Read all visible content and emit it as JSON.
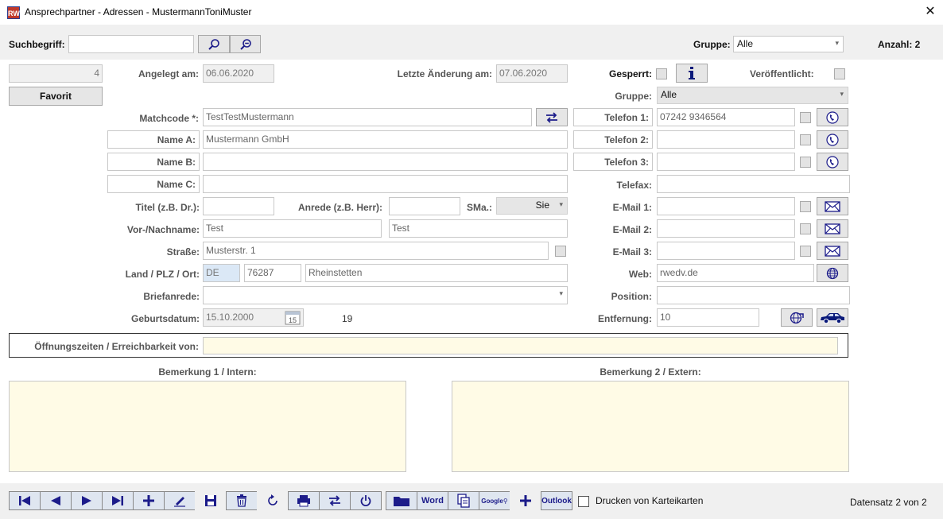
{
  "window": {
    "title": "Ansprechpartner - Adressen - MustermannToniMuster",
    "app_icon": "RW"
  },
  "search": {
    "label": "Suchbegriff:",
    "value": "",
    "group_label": "Gruppe:",
    "group_value": "Alle",
    "count_label": "Anzahl: 2"
  },
  "record": {
    "id": "4",
    "favorite_label": "Favorit",
    "created_label": "Angelegt am:",
    "created": "06.06.2020",
    "changed_label": "Letzte Änderung am:",
    "changed": "07.06.2020",
    "blocked_label": "Gesperrt:",
    "published_label": "Veröffentlicht:",
    "group_label": "Gruppe:",
    "group_value": "Alle",
    "matchcode_label": "Matchcode *:",
    "matchcode": "TestTestMustermann",
    "name_a_label": "Name A:",
    "name_a": "Mustermann GmbH",
    "name_b_label": "Name B:",
    "name_b": "",
    "name_c_label": "Name C:",
    "name_c": "",
    "title_label": "Titel (z.B. Dr.):",
    "title": "",
    "salutation_label": "Anrede (z.B. Herr):",
    "salutation": "",
    "sma_label": "SMa.:",
    "sma": "Sie",
    "name_label": "Vor-/Nachname:",
    "first_name": "Test",
    "last_name": "Test",
    "street_label": "Straße:",
    "street": "Musterstr. 1",
    "location_label": "Land / PLZ / Ort:",
    "country": "DE",
    "zip": "76287",
    "city": "Rheinstetten",
    "letter_salutation_label": "Briefanrede:",
    "letter_salutation": "",
    "birthday_label": "Geburtsdatum:",
    "birthday": "15.10.2000",
    "age": "19",
    "calendar_day": "15",
    "phone1_label": "Telefon 1:",
    "phone1": "07242 9346564",
    "phone2_label": "Telefon 2:",
    "phone2": "",
    "phone3_label": "Telefon 3:",
    "phone3": "",
    "fax_label": "Telefax:",
    "fax": "",
    "email1_label": "E-Mail 1:",
    "email1": "",
    "email2_label": "E-Mail 2:",
    "email2": "",
    "email3_label": "E-Mail 3:",
    "email3": "",
    "web_label": "Web:",
    "web": "rwedv.de",
    "position_label": "Position:",
    "position": "",
    "distance_label": "Entfernung:",
    "distance": "10",
    "hours_label": "Öffnungszeiten / Erreichbarkeit von:",
    "hours": "",
    "remark1_label": "Bemerkung 1 / Intern:",
    "remark1": "",
    "remark2_label": "Bemerkung 2 / Extern:",
    "remark2": ""
  },
  "toolbar": {
    "word_label": "Word",
    "google_label": "Google",
    "outlook_label": "Outlook",
    "print_cards_label": "Drucken von Karteikarten",
    "record_status": "Datensatz 2 von 2"
  },
  "colors": {
    "icon_blue": "#1c1c8a",
    "cream": "#fffbe6",
    "dark_blue": "#0a1a7a"
  }
}
